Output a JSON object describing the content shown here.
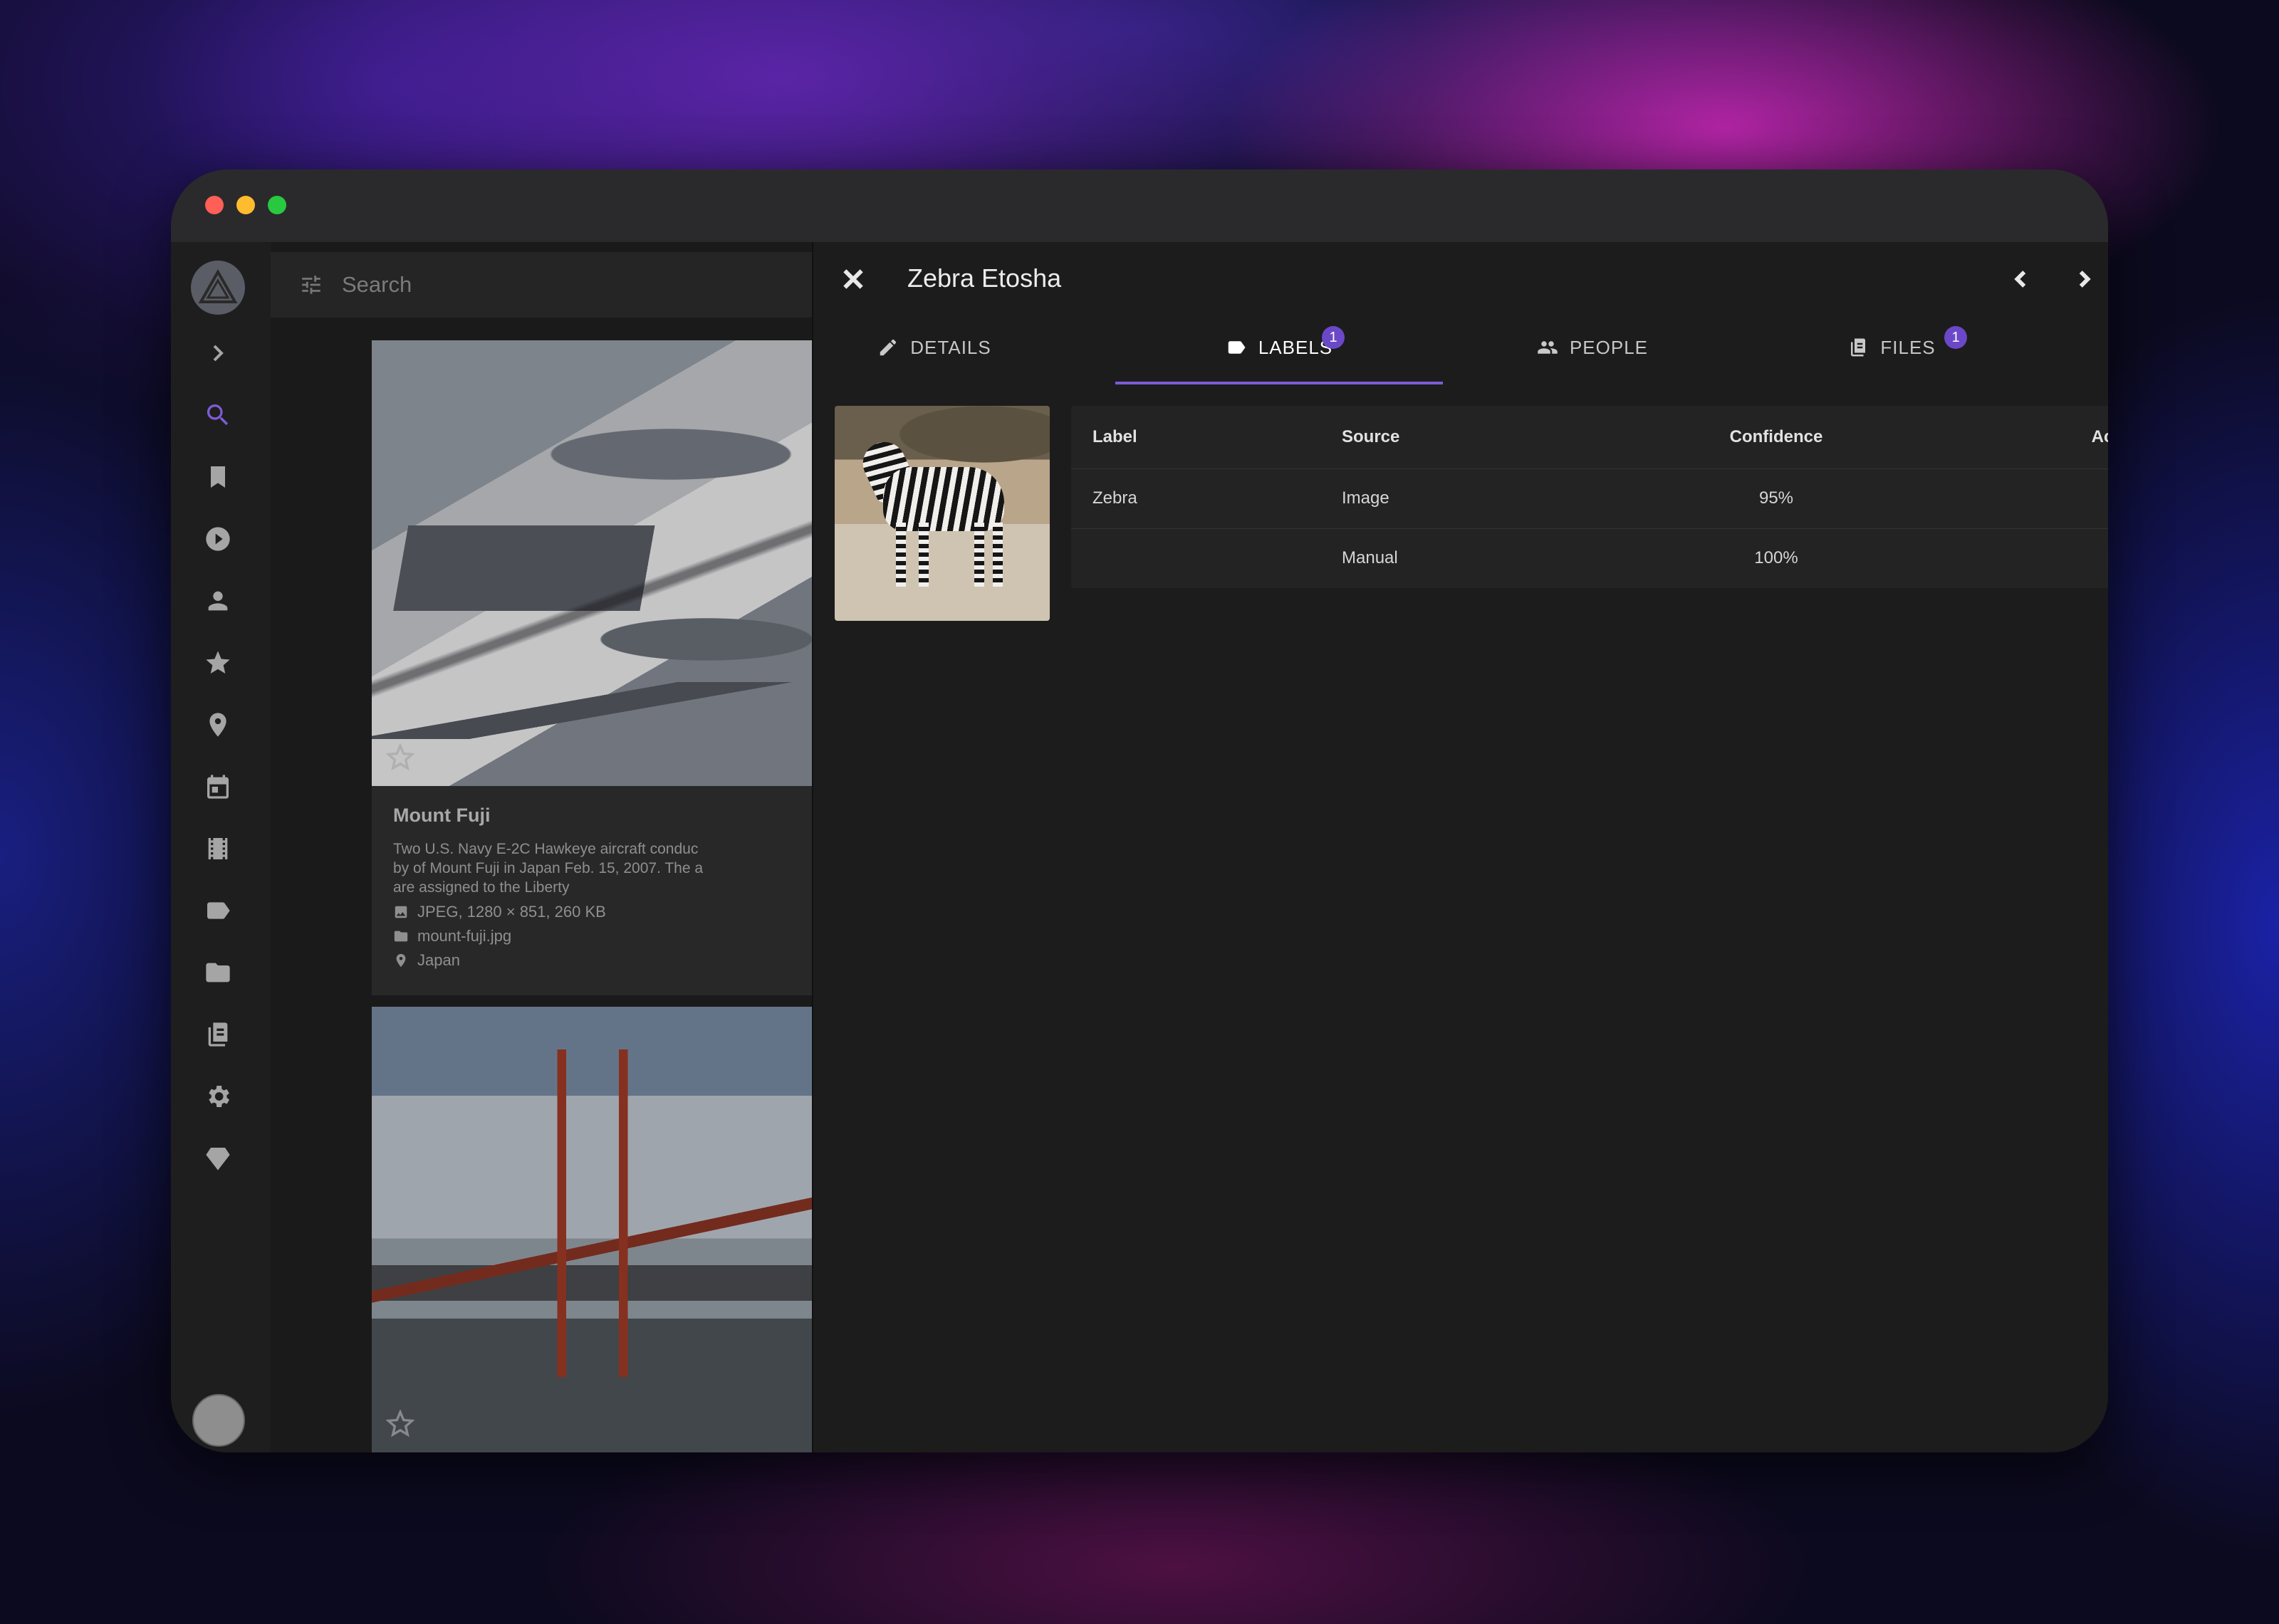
{
  "window": {
    "title_buttons": [
      "close",
      "minimize",
      "maximize"
    ]
  },
  "nav": {
    "icons": [
      "library-logo",
      "chevron-right-icon",
      "search-icon",
      "bookmark-icon",
      "play-circle-icon",
      "person-icon",
      "star-icon",
      "map-pin-icon",
      "calendar-icon",
      "film-icon",
      "label-icon",
      "folder-icon",
      "file-cabinet-icon",
      "gear-icon",
      "diamond-icon",
      "avatar"
    ]
  },
  "browse": {
    "search_placeholder": "Search",
    "cards": [
      {
        "title": "Mount Fuji",
        "description_lines": [
          "Two U.S. Navy E-2C Hawkeye aircraft conduc",
          "by of Mount Fuji in Japan Feb. 15, 2007. The a",
          "are assigned to the Liberty"
        ],
        "file_info": "JPEG, 1280 × 851, 260 KB",
        "filename": "mount-fuji.jpg",
        "location": "Japan"
      }
    ]
  },
  "panel": {
    "title": "Zebra Etosha",
    "tabs": [
      {
        "label": "DETAILS",
        "icon": "pencil-icon"
      },
      {
        "label": "LABELS",
        "icon": "label-icon",
        "badge": "1",
        "active": true
      },
      {
        "label": "PEOPLE",
        "icon": "people-icon"
      },
      {
        "label": "FILES",
        "icon": "file-cabinet-icon",
        "badge": "1"
      }
    ],
    "table": {
      "headers": {
        "label": "Label",
        "source": "Source",
        "confidence": "Confidence",
        "action": "Action"
      },
      "rows": [
        {
          "label": "Zebra",
          "source": "Image",
          "confidence": "95%",
          "action": "remove"
        },
        {
          "label": "",
          "source": "Manual",
          "confidence": "100%",
          "action": "add"
        }
      ]
    }
  },
  "colors": {
    "accent": "#7d5cd6",
    "badge": "#6b48c8",
    "panel_bg": "#1c1c1c",
    "table_bg": "#232323"
  }
}
